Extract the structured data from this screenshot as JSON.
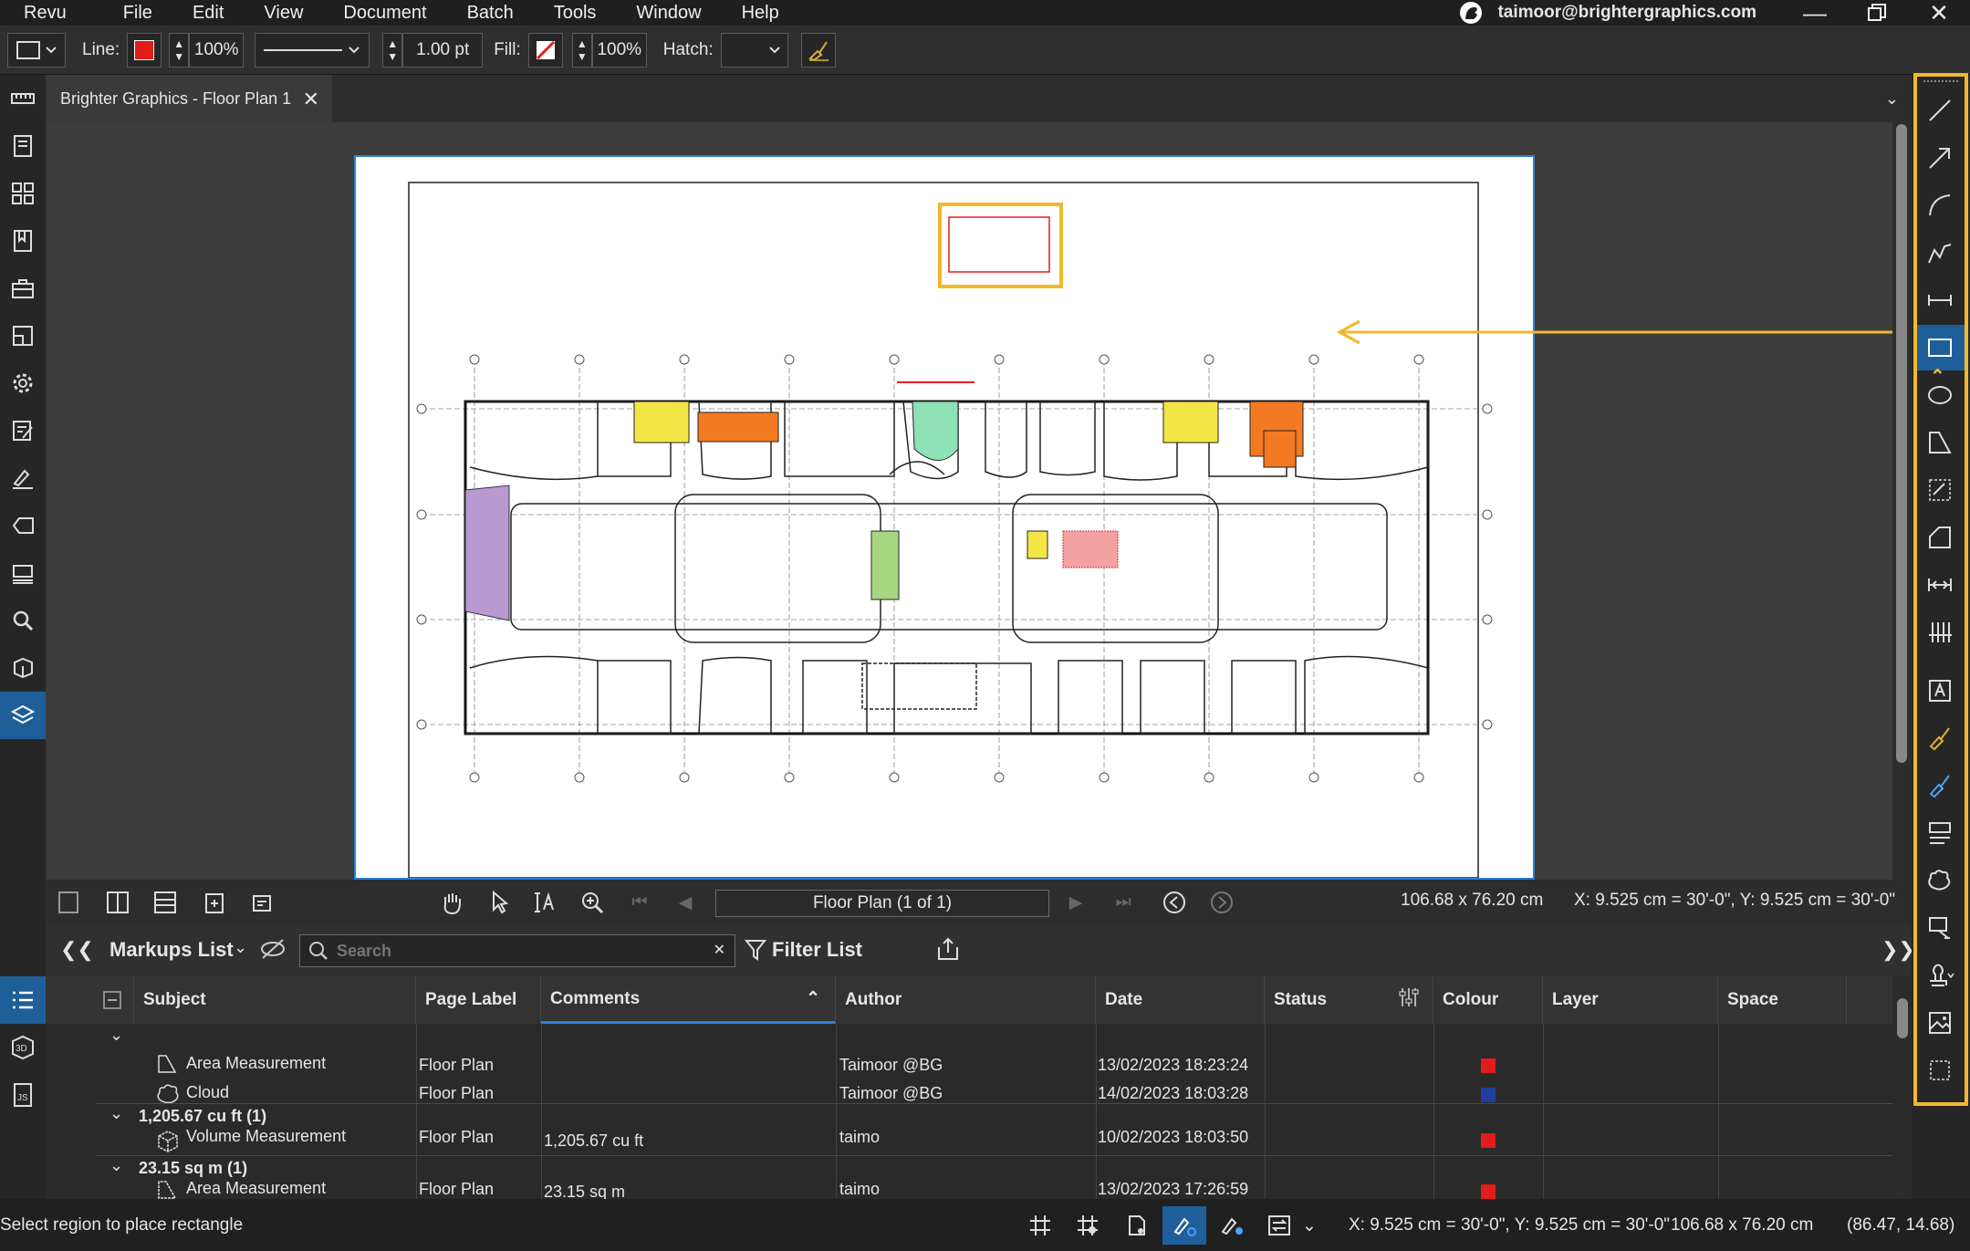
{
  "menu": {
    "brand": "Revu",
    "items": [
      "File",
      "Edit",
      "View",
      "Document",
      "Batch",
      "Tools",
      "Window",
      "Help"
    ],
    "user_email": "taimoor@brightergraphics.com"
  },
  "props": {
    "line_label": "Line:",
    "line_opacity": "100%",
    "line_width": "1.00 pt",
    "fill_label": "Fill:",
    "fill_opacity": "100%",
    "hatch_label": "Hatch:",
    "line_color": "#e21b1b"
  },
  "tab": {
    "title": "Brighter Graphics - Floor Plan 1"
  },
  "nav": {
    "page_field": "Floor Plan (1 of 1)",
    "page_size": "106.68 x 76.20 cm",
    "coords": "X: 9.525 cm = 30'-0\", Y: 9.525 cm = 30'-0\""
  },
  "markups": {
    "title": "Markups List",
    "search_placeholder": "Search",
    "filter_label": "Filter List",
    "columns": [
      "Subject",
      "Page Label",
      "Comments",
      "Author",
      "Date",
      "Status",
      "Colour",
      "Layer",
      "Space"
    ],
    "rows": [
      {
        "subject": "Area Measurement",
        "page": "Floor Plan",
        "comment": "",
        "author": "Taimoor @BG",
        "date": "13/02/2023 18:23:24",
        "colour": "#e21b1b"
      },
      {
        "subject": "Cloud",
        "page": "Floor Plan",
        "comment": "",
        "author": "Taimoor @BG",
        "date": "14/02/2023 18:03:28",
        "colour": "#1f3fa0"
      },
      {
        "group": "1,205.67 cu ft (1)"
      },
      {
        "subject": "Volume Measurement",
        "page": "Floor Plan",
        "comment": "1,205.67 cu ft",
        "author": "taimo",
        "date": "10/02/2023 18:03:50",
        "colour": "#e21b1b"
      },
      {
        "group": "23.15 sq m (1)"
      },
      {
        "subject": "Area Measurement",
        "page": "Floor Plan",
        "comment": "23.15 sq m",
        "author": "taimo",
        "date": "13/02/2023 17:26:59",
        "colour": "#e21b1b"
      }
    ]
  },
  "status": {
    "message": "Select region to place rectangle",
    "coords": "X: 9.525 cm = 30'-0\", Y: 9.525 cm = 30'-0\"",
    "size": "106.68 x 76.20 cm",
    "cursor": "(86.47, 14.68)"
  },
  "colors": {
    "accent": "#1f5f99",
    "highlight": "#f1b92a"
  }
}
